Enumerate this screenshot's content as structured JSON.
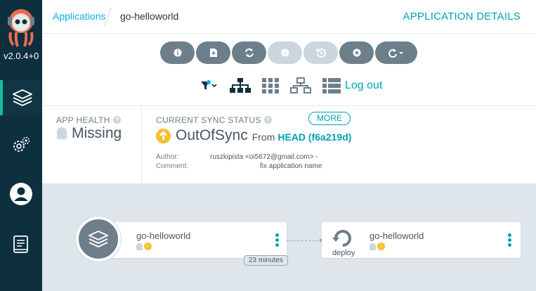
{
  "nav": {
    "version": "v2.0.4+0",
    "items": [
      {
        "name": "applications-icon"
      },
      {
        "name": "settings-icon"
      },
      {
        "name": "user-icon"
      },
      {
        "name": "docs-icon"
      }
    ]
  },
  "header": {
    "breadcrumb_root": "Applications",
    "breadcrumb_current": "go-helloworld",
    "title": "APPLICATION DETAILS"
  },
  "toolbar": {
    "buttons": [
      {
        "icon": "info-icon",
        "enabled": true
      },
      {
        "icon": "diff-icon",
        "enabled": true
      },
      {
        "icon": "sync-icon",
        "enabled": true
      },
      {
        "icon": "info-icon",
        "enabled": false
      },
      {
        "icon": "history-icon",
        "enabled": false
      },
      {
        "icon": "delete-icon",
        "enabled": true
      },
      {
        "icon": "refresh-icon",
        "enabled": true
      }
    ]
  },
  "views": {
    "logout_label": "Log out"
  },
  "status": {
    "health_label": "APP HEALTH",
    "health_value": "Missing",
    "sync_label": "CURRENT SYNC STATUS",
    "more_label": "MORE",
    "sync_value": "OutOfSync",
    "from_label": "From",
    "head_link": "HEAD (f6a219d)",
    "author_label": "Author:",
    "author_value": "ruszkipista <oi5672@gmail.com> -",
    "comment_label": "Comment:",
    "comment_value": "fix application name"
  },
  "graph": {
    "app_node": {
      "name": "go-helloworld"
    },
    "edge_label": "23 minutes",
    "deploy_node": {
      "name": "go-helloworld",
      "kind": "deploy"
    }
  },
  "colors": {
    "nav_bg": "#0d2f3e",
    "accent": "#00a2b3",
    "link": "#0dadea",
    "out_of_sync": "#f4c030",
    "canvas_bg": "#dee6eb"
  }
}
